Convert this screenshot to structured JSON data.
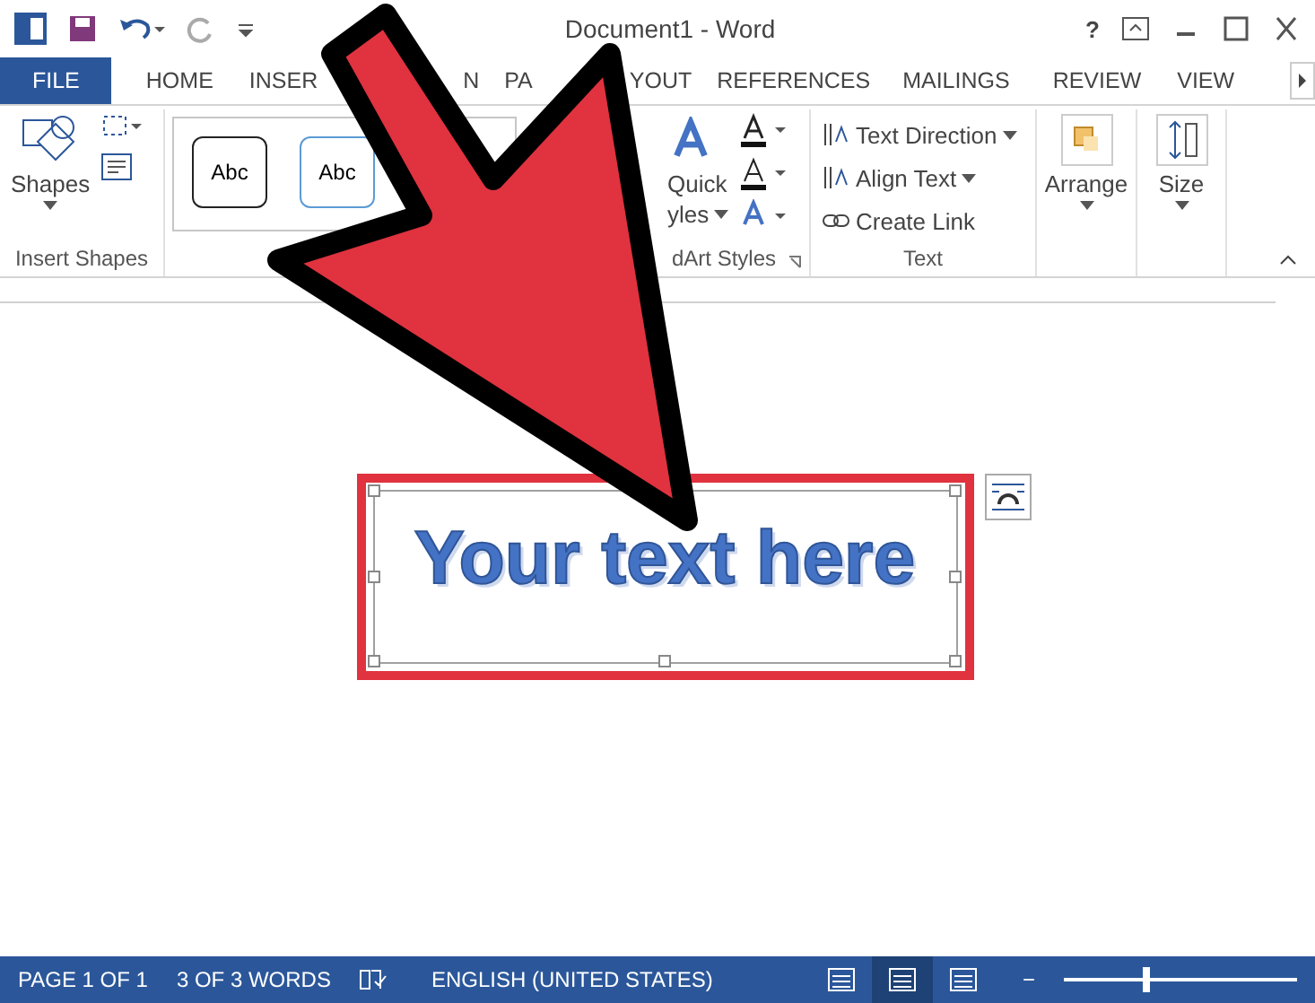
{
  "window": {
    "title": "Document1 - Word",
    "help": "?"
  },
  "tabs": [
    {
      "label": "FILE",
      "kind": "file",
      "selected": false
    },
    {
      "label": "HOME",
      "kind": "tab",
      "selected": false
    },
    {
      "label": "INSER",
      "kind": "tab",
      "selected": false
    },
    {
      "label": "N",
      "kind": "tab",
      "selected": false
    },
    {
      "label": "PA",
      "kind": "tab",
      "selected": false
    },
    {
      "label": "YOUT",
      "kind": "tab",
      "selected": false
    },
    {
      "label": "REFERENCES",
      "kind": "tab",
      "selected": false
    },
    {
      "label": "MAILINGS",
      "kind": "tab",
      "selected": false
    },
    {
      "label": "REVIEW",
      "kind": "tab",
      "selected": false
    },
    {
      "label": "VIEW",
      "kind": "tab",
      "selected": false
    }
  ],
  "insert_shapes": {
    "button": "Shapes",
    "label": "Insert Shapes"
  },
  "shape_styles": {
    "samples": [
      "Abc",
      "Abc"
    ]
  },
  "wordart_styles": {
    "button_top": "Quick",
    "button_bottom": "yles",
    "label": "dArt Styles"
  },
  "text_group": {
    "items": [
      {
        "label": "Text Direction",
        "kind": "menu"
      },
      {
        "label": "Align Text",
        "kind": "menu"
      },
      {
        "label": "Create Link",
        "kind": "plain"
      }
    ],
    "label": "Text"
  },
  "arrange": {
    "button": "Arrange"
  },
  "size": {
    "button": "Size"
  },
  "document": {
    "textbox": {
      "text": "Your text here"
    }
  },
  "status_bar": {
    "page": "PAGE 1 OF 1",
    "words": "3 OF 3 WORDS",
    "language": "ENGLISH (UNITED STATES)",
    "views": [
      {
        "selected": false
      },
      {
        "selected": true
      },
      {
        "selected": false
      }
    ],
    "zoom_minus": "−",
    "zoom": {
      "level": 0.35
    }
  }
}
